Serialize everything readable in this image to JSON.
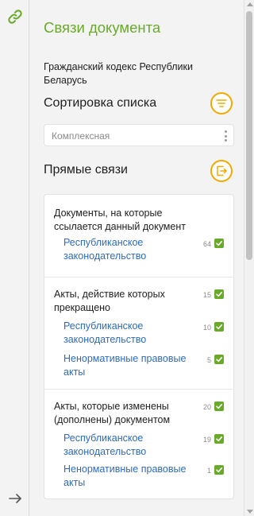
{
  "rail": {
    "link_icon": "link-icon",
    "collapse_icon": "arrow-right-icon"
  },
  "panel": {
    "title": "Связи документа",
    "document_name": "Гражданский кодекс Республики Беларусь"
  },
  "sort": {
    "title": "Сортировка списка",
    "selected": "Комплексная",
    "button_icon": "sort-icon"
  },
  "links": {
    "title": "Прямые связи",
    "button_icon": "export-icon",
    "groups": [
      {
        "title": "Документы, на которые ссылается данный документ",
        "count": "",
        "items": [
          {
            "label": "Республиканское законодательство",
            "count": "64"
          }
        ]
      },
      {
        "title": "Акты, действие которых прекращено",
        "count": "15",
        "items": [
          {
            "label": "Республиканское законодательство",
            "count": "10"
          },
          {
            "label": "Ненормативные правовые акты",
            "count": "5"
          }
        ]
      },
      {
        "title": "Акты, которые изменены (дополнены) документом",
        "count": "20",
        "items": [
          {
            "label": "Республиканское законодательство",
            "count": "19"
          },
          {
            "label": "Ненормативные правовые акты",
            "count": "1"
          }
        ]
      }
    ]
  },
  "colors": {
    "accent_green": "#6aaa2a",
    "accent_orange": "#f2a900",
    "link_blue": "#2e6bbd"
  }
}
